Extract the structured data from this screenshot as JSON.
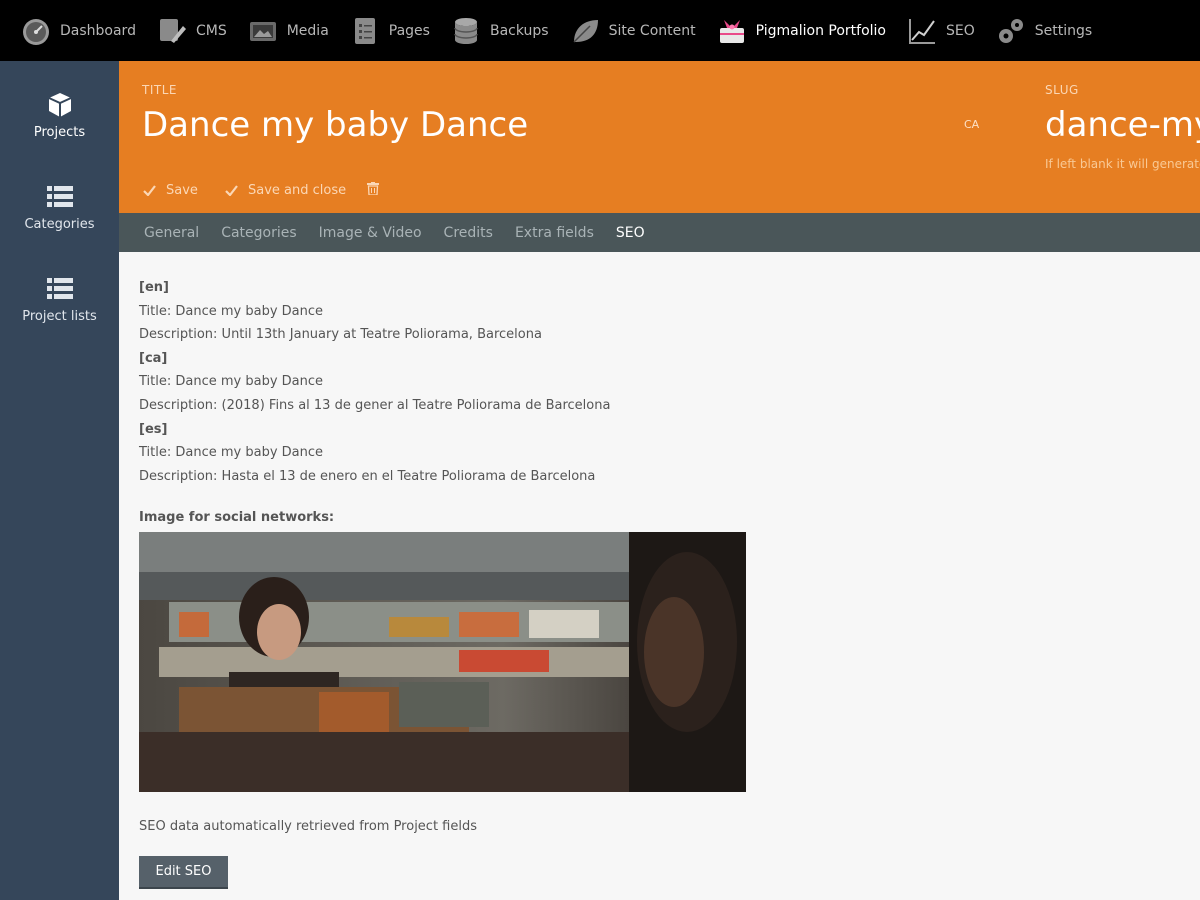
{
  "topnav": {
    "items": [
      {
        "label": "Dashboard",
        "icon": "speedometer-icon"
      },
      {
        "label": "CMS",
        "icon": "cms-icon"
      },
      {
        "label": "Media",
        "icon": "media-icon"
      },
      {
        "label": "Pages",
        "icon": "pages-icon"
      },
      {
        "label": "Backups",
        "icon": "database-icon"
      },
      {
        "label": "Site Content",
        "icon": "leaf-icon"
      },
      {
        "label": "Pigmalion Portfolio",
        "icon": "portfolio-icon"
      },
      {
        "label": "SEO",
        "icon": "chart-icon"
      },
      {
        "label": "Settings",
        "icon": "gears-icon"
      }
    ],
    "active": "Pigmalion Portfolio"
  },
  "sidebar": {
    "items": [
      {
        "label": "Projects",
        "icon": "cube-icon"
      },
      {
        "label": "Categories",
        "icon": "list-icon"
      },
      {
        "label": "Project lists",
        "icon": "list-icon"
      }
    ]
  },
  "header": {
    "title_label": "TITLE",
    "title_value": "Dance my baby Dance",
    "lang": "CA",
    "slug_label": "SLUG",
    "slug_value": "dance-my-",
    "slug_hint": "If left blank it will generate",
    "save_label": "Save",
    "save_close_label": "Save and close"
  },
  "tabs": [
    "General",
    "Categories",
    "Image & Video",
    "Credits",
    "Extra fields",
    "SEO"
  ],
  "active_tab": "SEO",
  "seo": {
    "en": {
      "code": "[en]",
      "title": "Title: Dance my baby Dance",
      "description": "Description: Until 13th January at Teatre Poliorama, Barcelona"
    },
    "ca": {
      "code": "[ca]",
      "title": "Title: Dance my baby Dance",
      "description": "Description: (2018) Fins al 13 de gener al Teatre Poliorama de Barcelona"
    },
    "es": {
      "code": "[es]",
      "title": "Title: Dance my baby Dance",
      "description": "Description: Hasta el 13 de enero en el Teatre Poliorama de Barcelona"
    },
    "social_label": "Image for social networks:",
    "auto_note": "SEO data automatically retrieved from Project fields",
    "edit_button": "Edit SEO"
  },
  "colors": {
    "header": "#e67e22",
    "sidebar": "#35465a",
    "tabs": "#4a5659",
    "topnav": "#000000"
  }
}
